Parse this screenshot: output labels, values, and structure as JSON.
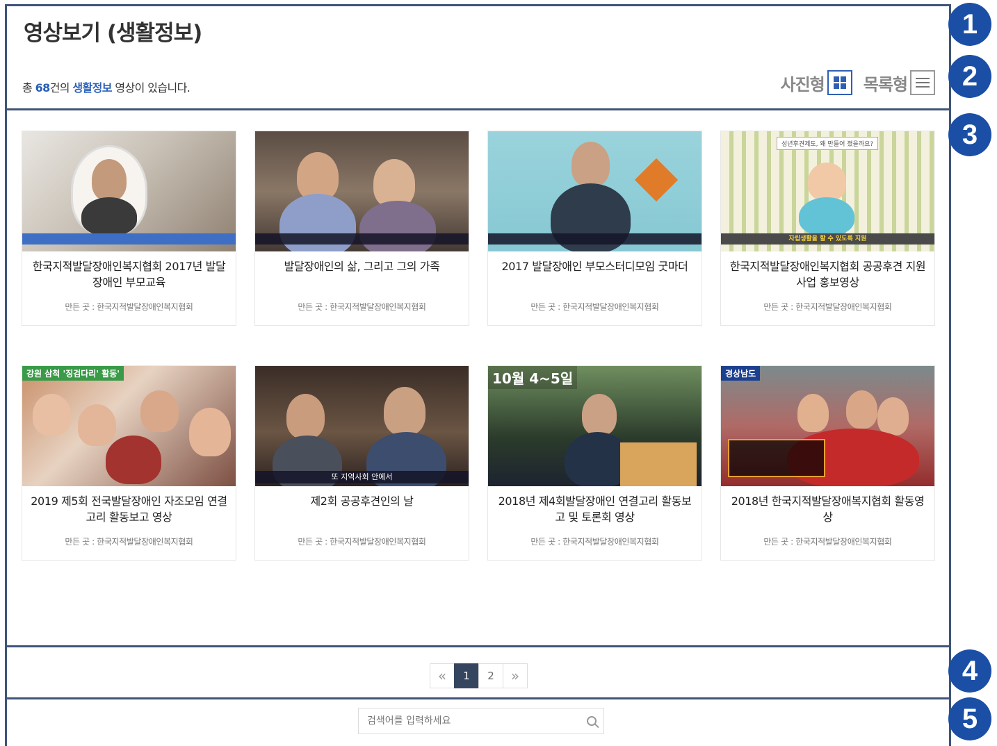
{
  "header": {
    "title": "영상보기 (생활정보)"
  },
  "summary": {
    "prefix": "총 ",
    "count": "68",
    "middle": "건의 ",
    "category": "생활정보",
    "suffix": " 영상이 있습니다."
  },
  "view_toggle": {
    "photo_label": "사진형",
    "list_label": "목록형",
    "selected": "사진형"
  },
  "videos": [
    {
      "title": "한국지적발달장애인복지협회 2017년 발달장애인 부모교육",
      "maker": "만든 곳 : 한국지적발달장애인복지협회"
    },
    {
      "title": "발달장애인의 삶, 그리고 그의 가족",
      "maker": "만든 곳 : 한국지적발달장애인복지협회"
    },
    {
      "title": "2017 발달장애인 부모스터디모임 굿마더",
      "maker": "만든 곳 : 한국지적발달장애인복지협회"
    },
    {
      "title": "한국지적발달장애인복지협회 공공후견 지원사업 홍보영상",
      "maker": "만든 곳 : 한국지적발달장애인복지협회"
    },
    {
      "title": "2019 제5회 전국발달장애인 자조모임 연결고리 활동보고 영상",
      "maker": "만든 곳 : 한국지적발달장애인복지협회"
    },
    {
      "title": "제2회 공공후견인의 날",
      "maker": "만든 곳 : 한국지적발달장애인복지협회"
    },
    {
      "title": "2018년 제4회발달장애인 연결고리 활동보고 및 토론회 영상",
      "maker": "만든 곳 : 한국지적발달장애인복지협회"
    },
    {
      "title": "2018년 한국지적발달장애복지협회 활동영상",
      "maker": "만든 곳 : 한국지적발달장애인복지협회"
    }
  ],
  "thumb_text": {
    "t4_caption": "자립생활을 할 수 있도록 지원",
    "t4_top": "성년후견제도, 왜 만들어 졌을까요?",
    "t5_top": "강원 삼척 '징검다리' 활동'",
    "t6_caption": "또 지역사회 안에서",
    "t7_top": "10월 4~5일",
    "t8_top": "경상남도"
  },
  "pagination": {
    "prev": "«",
    "pages": [
      "1",
      "2"
    ],
    "current": "1",
    "next": "»"
  },
  "search": {
    "placeholder": "검색어를 입력하세요"
  },
  "badges": [
    "1",
    "2",
    "3",
    "4",
    "5"
  ],
  "colors": {
    "frame": "#3f5478",
    "accent": "#2a5fb8",
    "badge": "#1b4fa6",
    "active_page": "#36455f"
  },
  "icons": {
    "photo_view": "grid-icon",
    "list_view": "list-icon",
    "search": "search-icon"
  }
}
